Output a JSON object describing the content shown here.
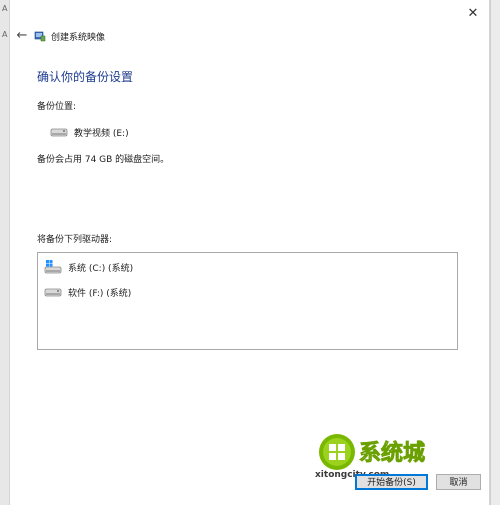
{
  "background": {
    "left_fragments": [
      "A",
      "A"
    ]
  },
  "window": {
    "title": "创建系统映像",
    "close_glyph": "✕",
    "back_glyph": "←",
    "heading": "确认你的备份设置",
    "location_label": "备份位置:",
    "location_drive": "教学视频 (E:)",
    "usage_text": "备份会占用 74 GB 的磁盘空间。",
    "drives_label": "将备份下列驱动器:",
    "drives": [
      {
        "label": "系统 (C:) (系统)",
        "icon": "windows-drive-icon"
      },
      {
        "label": "软件 (F:) (系统)",
        "icon": "hard-drive-icon"
      }
    ],
    "buttons": {
      "start": "开始备份(S)",
      "cancel": "取消"
    }
  },
  "watermark": {
    "brand": "系统城",
    "domain": "xitongcity.com"
  },
  "colors": {
    "heading": "#1e3d8f",
    "accent": "#0078d7",
    "windows_blue": "#1e90ff",
    "watermark_green": "#7ab800"
  }
}
